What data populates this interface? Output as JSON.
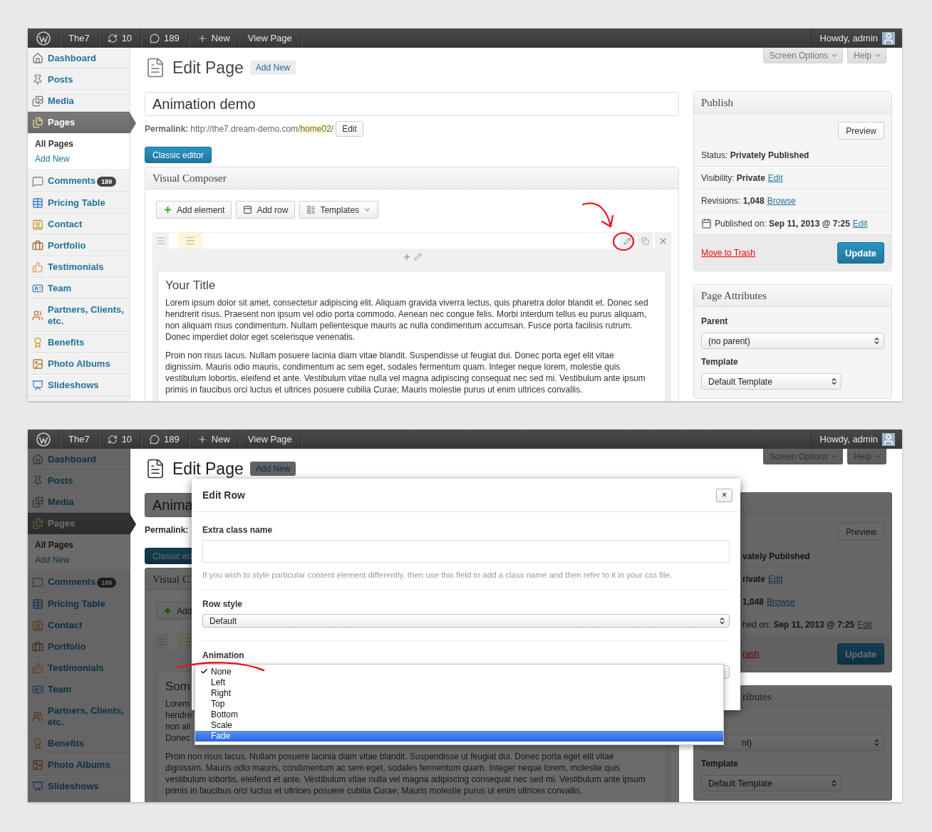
{
  "screens": [
    {
      "admin_bar": {
        "items": [
          {
            "label": "The7"
          },
          {
            "label": "10"
          },
          {
            "label": "189"
          },
          {
            "label": "New"
          },
          {
            "label": "View Page"
          }
        ],
        "account": "Howdy, admin"
      },
      "sidebar": [
        {
          "label": "Dashboard",
          "selected": false
        },
        {
          "label": "Posts",
          "selected": false
        },
        {
          "label": "Media",
          "selected": false
        },
        {
          "label": "Pages",
          "selected": true,
          "children": [
            {
              "label": "All Pages",
              "selected": true
            },
            {
              "label": "Add New",
              "selected": false
            }
          ]
        },
        {
          "label": "Comments",
          "selected": false,
          "badge": "189"
        },
        {
          "label": "Pricing Table",
          "selected": false
        },
        {
          "label": "Contact",
          "selected": false
        },
        {
          "label": "Portfolio",
          "selected": false
        },
        {
          "label": "Testimonials",
          "selected": false
        },
        {
          "label": "Team",
          "selected": false
        },
        {
          "label": "Partners, Clients, etc.",
          "selected": false
        },
        {
          "label": "Benefits",
          "selected": false
        },
        {
          "label": "Photo Albums",
          "selected": false
        },
        {
          "label": "Slideshows",
          "selected": false
        }
      ],
      "screen_tabs": [
        "Screen Options",
        "Help"
      ],
      "header": {
        "title": "Edit Page",
        "action": "Add New"
      },
      "title_field": "Animation demo",
      "permalink": {
        "label": "Permalink:",
        "url": "http://the7.dream-demo.com/",
        "slug": "home02",
        "trail": "/",
        "button": "Edit"
      },
      "classic_editor": "Classic editor",
      "composer": {
        "title": "Visual Composer",
        "buttons": [
          "Add element",
          "Add row",
          "Templates"
        ],
        "heading": "Your Title",
        "paragraphs": [
          {
            "kind": "text",
            "text": "Lorem ipsum dolor sit amet, consectetur adipiscing elit. Aliquam gravida viverra lectus, quis pharetra dolor blandit et. Donec sed hendrerit risus. Praesent non ipsum vel odio porta commodo. Aenean nec congue felis. Morbi interdum tellus eu purus aliquam, non aliquam risus condimentum. Nullam pellentesque mauris ac nulla condimentum accumsan. Fusce porta facilisis rutrum. Donec imperdiet dolor eget scelerisque venenatis."
          },
          {
            "kind": "text",
            "text": "Proin non risus lacus. Nullam posuere lacinia diam vitae blandit. Suspendisse ut feugiat dui. Donec porta eget elit vitae dignissim. Mauris odio mauris, condimentum ac sem eget, sodales fermentum quam. Integer neque lorem, molestie quis vestibulum lobortis, eleifend et ante. Vestibulum vitae nulla vel magna adipiscing consequat nec sed mi. Vestibulum ante ipsum primis in faucibus orci luctus et ultrices posuere cubilia Curae; Mauris molestie purus ut enim ultrices convallis."
          }
        ]
      },
      "publish": {
        "title": "Publish",
        "preview": "Preview",
        "rows": [
          {
            "kind": "text",
            "label": "Status:",
            "value": "Privately Published"
          },
          {
            "kind": "text",
            "label": "Visibility:",
            "value": "Private",
            "link": "Edit"
          },
          {
            "kind": "text",
            "label": "Revisions:",
            "value": "1,048",
            "link": "Browse"
          },
          {
            "kind": "date",
            "label": "Published on:",
            "value": "Sep 11, 2013 @ 7:25",
            "link": "Edit"
          }
        ],
        "trash": "Move to Trash",
        "update": "Update"
      },
      "page_attributes": {
        "title": "Page Attributes",
        "parent_label": "Parent",
        "parent": "(no parent)",
        "template_label": "Template",
        "template": "Default Template"
      }
    },
    {
      "admin_bar": {
        "items": [
          {
            "label": "The7"
          },
          {
            "label": "10"
          },
          {
            "label": "189"
          },
          {
            "label": "New"
          },
          {
            "label": "View Page"
          }
        ],
        "account": "Howdy, admin"
      },
      "sidebar": [
        {
          "label": "Dashboard",
          "selected": false
        },
        {
          "label": "Posts",
          "selected": false
        },
        {
          "label": "Media",
          "selected": false
        },
        {
          "label": "Pages",
          "selected": true,
          "children": [
            {
              "label": "All Pages",
              "selected": true
            },
            {
              "label": "Add New",
              "selected": false
            }
          ]
        },
        {
          "label": "Comments",
          "selected": false,
          "badge": "189"
        },
        {
          "label": "Pricing Table",
          "selected": false
        },
        {
          "label": "Contact",
          "selected": false
        },
        {
          "label": "Portfolio",
          "selected": false
        },
        {
          "label": "Testimonials",
          "selected": false
        },
        {
          "label": "Team",
          "selected": false
        },
        {
          "label": "Partners, Clients, etc.",
          "selected": false
        },
        {
          "label": "Benefits",
          "selected": false
        },
        {
          "label": "Photo Albums",
          "selected": false
        },
        {
          "label": "Slideshows",
          "selected": false
        }
      ],
      "screen_tabs": [
        "Screen Options",
        "Help"
      ],
      "header": {
        "title": "Edit Page",
        "action": "Add New"
      },
      "title_field": "Anima",
      "permalink": {
        "label": "Permalink:"
      },
      "classic_editor": "Classic ed",
      "composer": {
        "title": "Visual C",
        "buttons": [
          "Add"
        ],
        "heading": "Som",
        "paragraphs": [
          {
            "kind": "lines",
            "lines": [
              "Lorem",
              "hendre",
              "non ali",
              "Donec"
            ]
          },
          {
            "kind": "text",
            "text": "Proin non risus lacus. Nullam posuere lacinia diam vitae blandit. Suspendisse ut feugiat dui. Donec porta eget elit vitae dignissim. Mauris odio mauris, condimentum ac sem eget, sodales fermentum quam. Integer neque lorem, molestie quis vestibulum lobortis, eleifend et ante. Vestibulum vitae nulla vel magna adipiscing consequat nec sed mi. Vestibulum ante ipsum primis in faucibus orci luctus et ultrices posuere cubilia Curae; Mauris molestie purus ut enim ultrices convallis."
          }
        ]
      },
      "publish": {
        "preview": "Preview",
        "rows": [
          {
            "kind": "text",
            "value": "vately Published"
          },
          {
            "kind": "text",
            "value": "rivate",
            "link": "Edit"
          },
          {
            "kind": "text",
            "value": "1,048",
            "link": "Browse"
          },
          {
            "kind": "text",
            "label": "hed on:",
            "value": "Sep 11, 2013 @ 7:25",
            "link": "Edit"
          }
        ],
        "trash": "rash",
        "update": "Update"
      },
      "page_attributes": {
        "title": "ributes",
        "parent": "nt)",
        "template_label": "Template",
        "template": "Default Template"
      },
      "dialog": {
        "title": "Edit Row",
        "close": "×",
        "fields": [
          {
            "kind": "text",
            "label": "Extra class name",
            "help": "If you wish to style particular content element differently, then use this field to add a class name and then refer to it in your css file."
          },
          {
            "kind": "select",
            "label": "Row style",
            "value": "Default"
          },
          {
            "kind": "dropdown",
            "label": "Animation",
            "options": [
              {
                "label": "None",
                "checked": true,
                "highlighted": false
              },
              {
                "label": "Left",
                "checked": false,
                "highlighted": false
              },
              {
                "label": "Right",
                "checked": false,
                "highlighted": false
              },
              {
                "label": "Top",
                "checked": false,
                "highlighted": false
              },
              {
                "label": "Bottom",
                "checked": false,
                "highlighted": false
              },
              {
                "label": "Scale",
                "checked": false,
                "highlighted": false
              },
              {
                "label": "Fade",
                "checked": false,
                "highlighted": true
              }
            ]
          }
        ]
      }
    }
  ]
}
